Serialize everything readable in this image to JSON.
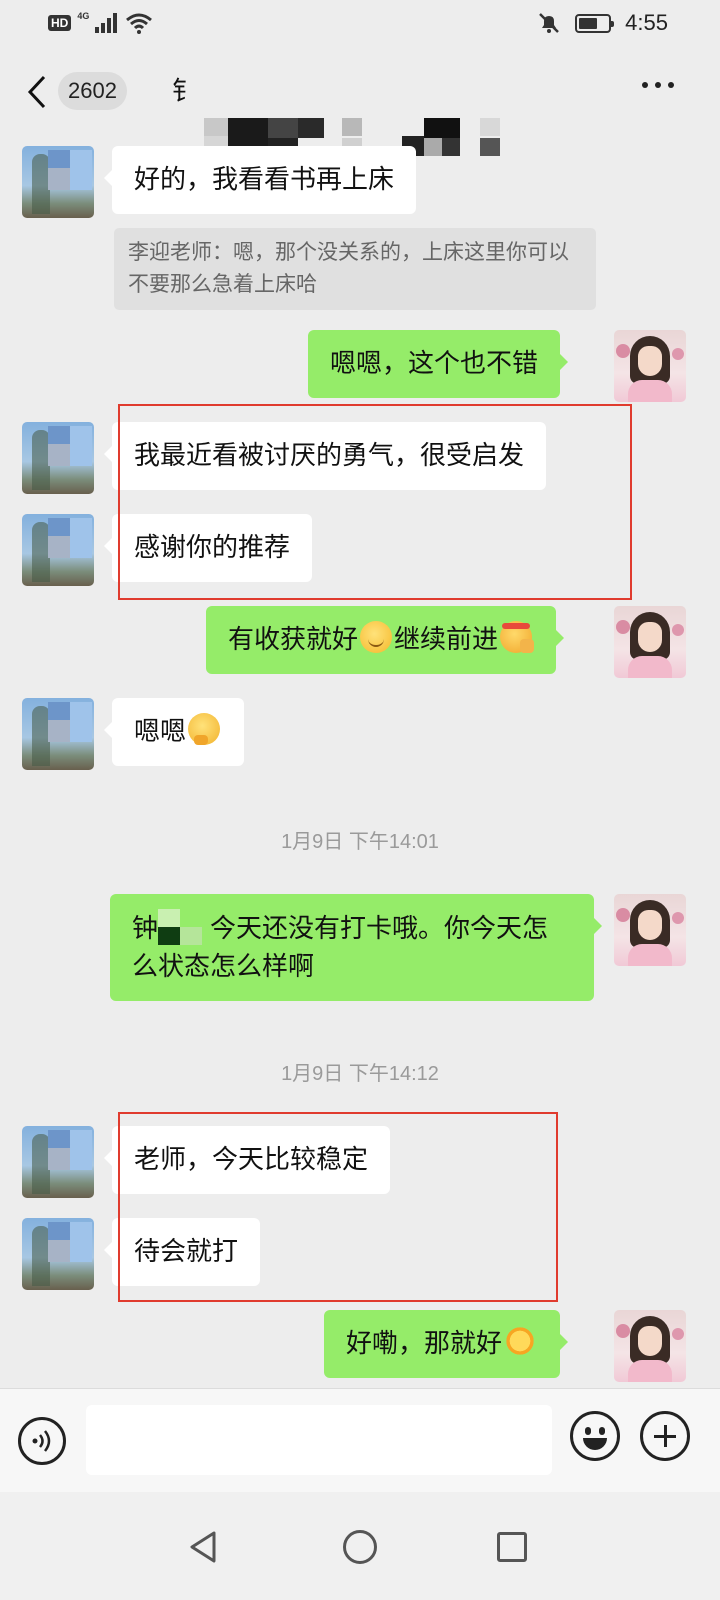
{
  "status_bar": {
    "hd": "HD",
    "network": "4G",
    "time": "4:55"
  },
  "header": {
    "unread_count": "2602",
    "title_visible": "钅"
  },
  "messages": {
    "m1": "好的，我看看书再上床",
    "quote": "李迎老师：嗯，那个没关系的，上床这里你可以不要那么急着上床哈",
    "m2": "嗯嗯，这个也不错",
    "m3": "我最近看被讨厌的勇气，很受启发",
    "m4": "感谢你的推荐",
    "m5_a": "有收获就好",
    "m5_b": "继续前进",
    "m6": "嗯嗯",
    "ts1": "1月9日 下午14:01",
    "m7_prefix": "钟",
    "m7_rest": "今天还没有打卡哦。你今天怎么状态怎么样啊",
    "ts2": "1月9日 下午14:12",
    "m8": "老师，今天比较稳定",
    "m9": "待会就打",
    "m10": "好嘞，那就好"
  },
  "icons": {
    "back": "chevron-left-icon",
    "more": "more-dots-icon",
    "mute": "bell-off-icon",
    "voice": "voice-icon",
    "emoji": "emoji-icon",
    "plus": "plus-icon"
  },
  "colors": {
    "outgoing_bubble": "#95ec69",
    "incoming_bubble": "#ffffff",
    "background": "#ededed",
    "highlight": "#e03b2e"
  }
}
